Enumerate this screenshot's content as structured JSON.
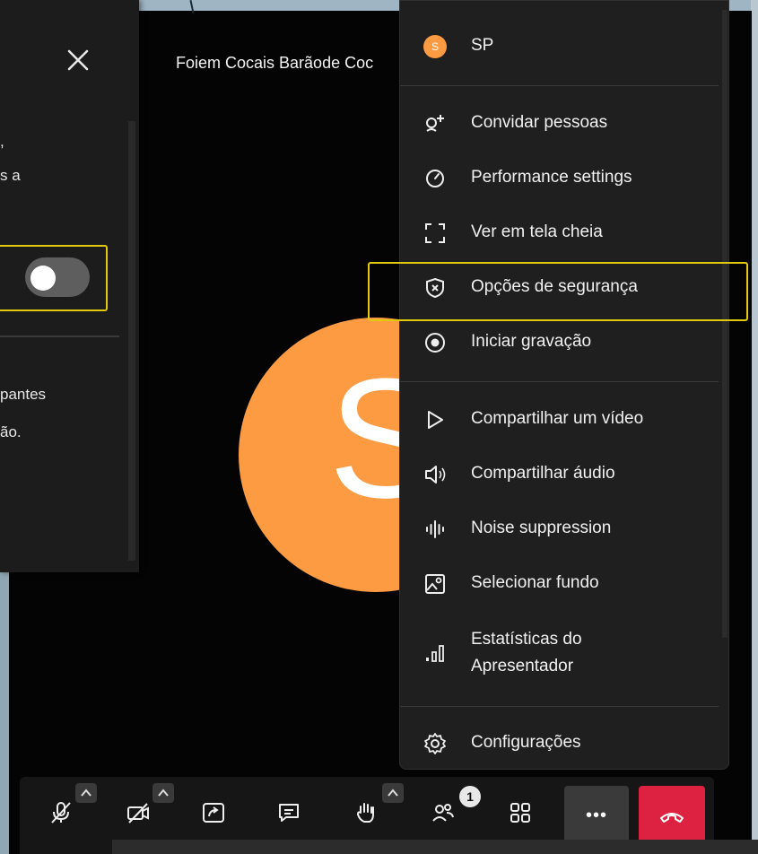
{
  "meeting": {
    "title": "Foiem Cocais Barãode Coc",
    "avatar_initial": "S"
  },
  "security_panel": {
    "text_lines": [
      ",",
      "s a"
    ],
    "text_lines2": [
      "pantes",
      "ão."
    ],
    "toggle_on": false
  },
  "menu": {
    "user": {
      "initials": "S",
      "name": "SP"
    },
    "items": [
      {
        "label": "Convidar pessoas",
        "icon": "invite-icon"
      },
      {
        "label": "Performance settings",
        "icon": "gauge-icon"
      },
      {
        "label": "Ver em tela cheia",
        "icon": "fullscreen-icon"
      },
      {
        "label": "Opções de segurança",
        "icon": "shield-icon"
      },
      {
        "label": "Iniciar gravação",
        "icon": "record-icon"
      },
      {
        "label": "Compartilhar um vídeo",
        "icon": "play-icon"
      },
      {
        "label": "Compartilhar áudio",
        "icon": "speaker-icon"
      },
      {
        "label": "Noise suppression",
        "icon": "waveform-icon"
      },
      {
        "label": "Selecionar fundo",
        "icon": "background-icon"
      },
      {
        "label": "Estatísticas do",
        "label2": "Apresentador",
        "icon": "stats-icon"
      },
      {
        "label": "Configurações",
        "icon": "gear-icon"
      }
    ]
  },
  "toolbar": {
    "participants_count": "1",
    "more_label": "•••"
  },
  "colors": {
    "accent_orange": "#fd9b43",
    "hangup_red": "#dd2241",
    "highlight_yellow": "#e2c80e"
  }
}
